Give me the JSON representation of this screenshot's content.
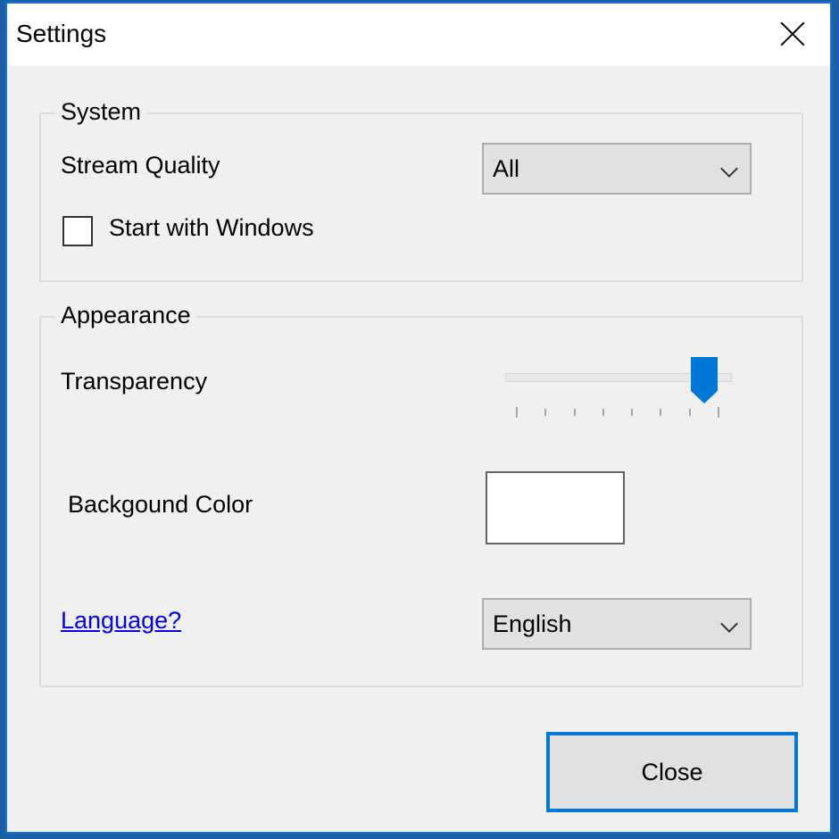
{
  "window": {
    "title": "Settings",
    "close_icon": "close-icon"
  },
  "system": {
    "legend": "System",
    "stream_quality_label": "Stream Quality",
    "stream_quality_value": "All",
    "start_with_windows_label": "Start with Windows",
    "start_with_windows_checked": false
  },
  "appearance": {
    "legend": "Appearance",
    "transparency_label": "Transparency",
    "transparency_slider": {
      "ticks": 8,
      "position_index": 7,
      "fraction": 0.9
    },
    "background_color_label": "Backgound Color",
    "background_color_value": "#ffffff",
    "language_link": "Language?",
    "language_value": "English"
  },
  "footer": {
    "close_button": "Close"
  },
  "colors": {
    "accent": "#0078d7",
    "link": "#0000ee"
  }
}
